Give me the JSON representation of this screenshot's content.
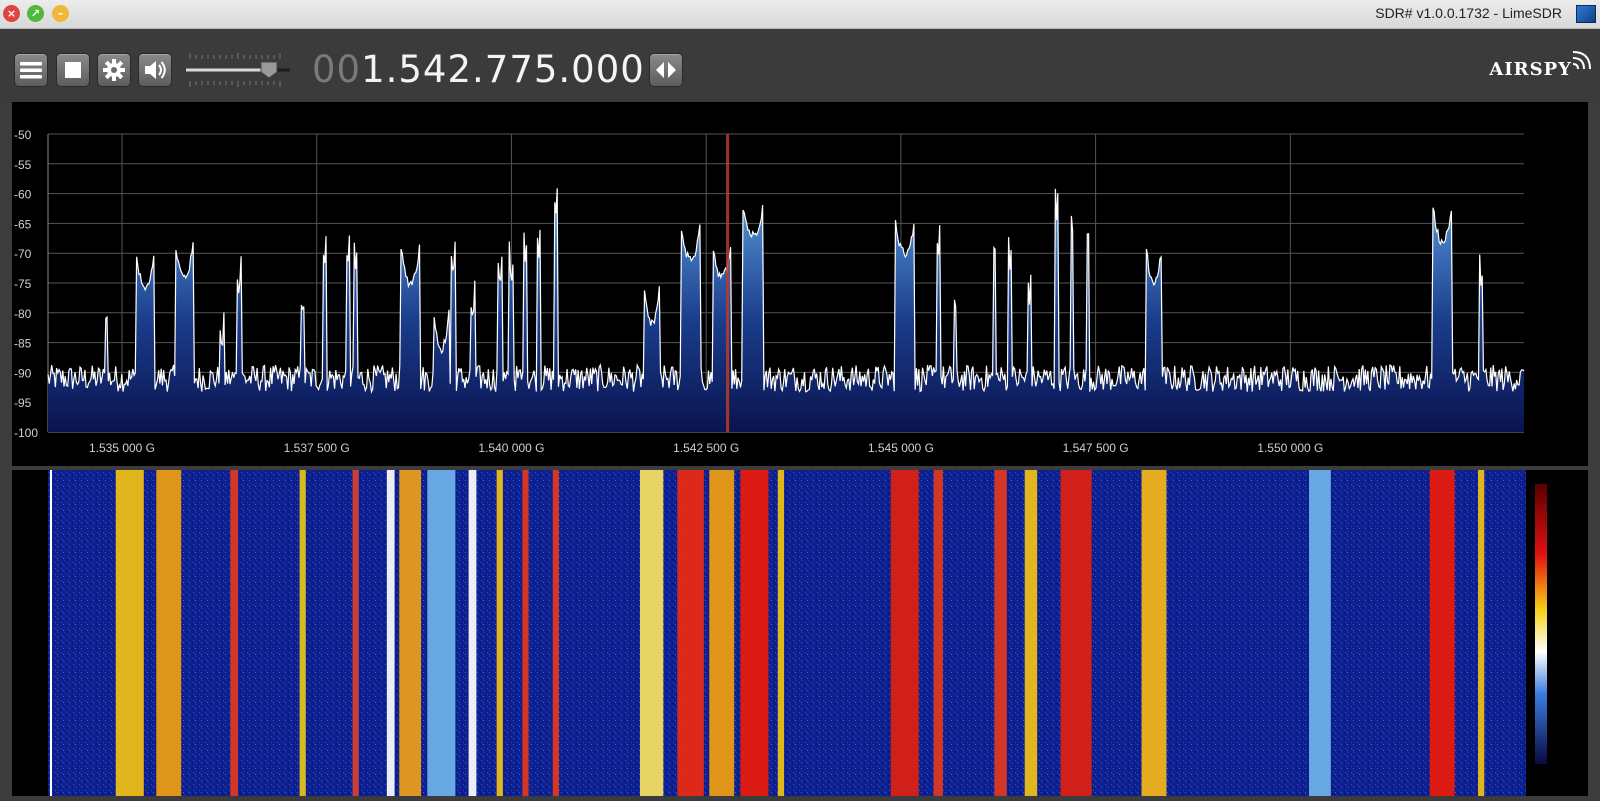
{
  "window": {
    "title": "SDR# v1.0.0.1732 - LimeSDR",
    "close_glyph": "×",
    "maximize_glyph": "↗",
    "minimize_glyph": "–"
  },
  "toolbar": {
    "menu_icon": "hamburger-menu-icon",
    "stop_icon": "stop-icon",
    "settings_icon": "gear-icon",
    "audio_icon": "speaker-icon",
    "volume_level": 0.8,
    "frequency_dim": "00",
    "frequency_main": "1.542.775.000",
    "tuning_icon": "left-right-arrows-icon",
    "logo": "AIRSPY"
  },
  "colors": {
    "background": "#3c3c3c",
    "plot_bg": "#000000",
    "trace": "#ffffff",
    "fill_top": "#4a8fd0",
    "fill_bottom": "#0a1550",
    "vfo_marker": "#c0392b",
    "waterfall_low": "#0c1f8c"
  },
  "chart_data": {
    "type": "area",
    "title": "",
    "xlabel": "",
    "ylabel": "",
    "x_unit": "GHz",
    "xlim": [
      1.53405,
      1.553
    ],
    "ylim": [
      -100,
      -50
    ],
    "y_ticks": [
      "-50",
      "-55",
      "-60",
      "-65",
      "-70",
      "-75",
      "-80",
      "-85",
      "-90",
      "-95",
      "-100"
    ],
    "x_ticks": [
      {
        "value": 1.535,
        "label": "1.535 000 G"
      },
      {
        "value": 1.5375,
        "label": "1.537 500 G"
      },
      {
        "value": 1.54,
        "label": "1.540 000 G"
      },
      {
        "value": 1.5425,
        "label": "1.542 500 G"
      },
      {
        "value": 1.545,
        "label": "1.545 000 G"
      },
      {
        "value": 1.5475,
        "label": "1.547 500 G"
      },
      {
        "value": 1.55,
        "label": "1.550 000 G"
      }
    ],
    "grid": true,
    "noise_floor_dB": -91,
    "vfo_frequency": 1.542775,
    "series": [
      {
        "values_note_free": true,
        "peaks": [
          {
            "f": 1.5348,
            "level": -82,
            "width": 2e-05
          },
          {
            "f": 1.5353,
            "level": -76,
            "width": 0.00012
          },
          {
            "f": 1.5358,
            "level": -74,
            "width": 0.00012
          },
          {
            "f": 1.53628,
            "level": -86,
            "width": 3e-05
          },
          {
            "f": 1.5365,
            "level": -76,
            "width": 3e-05
          },
          {
            "f": 1.53732,
            "level": -80,
            "width": 3e-05
          },
          {
            "f": 1.5376,
            "level": -72,
            "width": 2e-05
          },
          {
            "f": 1.5379,
            "level": -72,
            "width": 2e-05
          },
          {
            "f": 1.538,
            "level": -73,
            "width": 2e-05
          },
          {
            "f": 1.5387,
            "level": -75,
            "width": 0.00012
          },
          {
            "f": 1.5391,
            "level": -86,
            "width": 0.0001
          },
          {
            "f": 1.53925,
            "level": -73,
            "width": 3e-05
          },
          {
            "f": 1.5395,
            "level": -81,
            "width": 3e-05
          },
          {
            "f": 1.53985,
            "level": -75,
            "width": 3e-05
          },
          {
            "f": 1.54,
            "level": -74,
            "width": 3e-05
          },
          {
            "f": 1.54018,
            "level": -71,
            "width": 2e-05
          },
          {
            "f": 1.54035,
            "level": -70,
            "width": 2e-05
          },
          {
            "f": 1.54057,
            "level": -64,
            "width": 2e-05
          },
          {
            "f": 1.5418,
            "level": -82,
            "width": 0.0001
          },
          {
            "f": 1.5423,
            "level": -71,
            "width": 0.00013
          },
          {
            "f": 1.5427,
            "level": -74,
            "width": 0.00012
          },
          {
            "f": 1.5431,
            "level": -67,
            "width": 0.00014
          },
          {
            "f": 1.54505,
            "level": -70,
            "width": 0.00013
          },
          {
            "f": 1.54548,
            "level": -70,
            "width": 2e-05
          },
          {
            "f": 1.5457,
            "level": -80,
            "width": 2e-05
          },
          {
            "f": 1.5462,
            "level": -70,
            "width": 2e-05
          },
          {
            "f": 1.5464,
            "level": -72,
            "width": 2e-05
          },
          {
            "f": 1.54665,
            "level": -78,
            "width": 2e-05
          },
          {
            "f": 1.547,
            "level": -64,
            "width": 2e-05
          },
          {
            "f": 1.5472,
            "level": -66,
            "width": 2e-05
          },
          {
            "f": 1.5474,
            "level": -68,
            "width": 2e-05
          },
          {
            "f": 1.54825,
            "level": -75,
            "width": 0.0001
          },
          {
            "f": 1.55195,
            "level": -68,
            "width": 0.00012
          },
          {
            "f": 1.55245,
            "level": -76,
            "width": 2e-05
          }
        ]
      }
    ]
  },
  "waterfall_bands": [
    {
      "f": 1.5351,
      "w": 0.00018,
      "color": "#f3c212"
    },
    {
      "f": 1.5356,
      "w": 0.00016,
      "color": "#f0a010"
    },
    {
      "f": 1.53644,
      "w": 5e-05,
      "color": "#e23a1b"
    },
    {
      "f": 1.53732,
      "w": 4e-05,
      "color": "#e8c817"
    },
    {
      "f": 1.538,
      "w": 4e-05,
      "color": "#d94030"
    },
    {
      "f": 1.53845,
      "w": 5e-05,
      "color": "#ffffff"
    },
    {
      "f": 1.5387,
      "w": 0.00014,
      "color": "#f0a018"
    },
    {
      "f": 1.5391,
      "w": 0.00018,
      "color": "#6fb4ea"
    },
    {
      "f": 1.5395,
      "w": 5e-05,
      "color": "#ffffff"
    },
    {
      "f": 1.53985,
      "w": 4e-05,
      "color": "#f3c212"
    },
    {
      "f": 1.54018,
      "w": 4e-05,
      "color": "#e23a1b"
    },
    {
      "f": 1.54057,
      "w": 4e-05,
      "color": "#e23a1b"
    },
    {
      "f": 1.5418,
      "w": 0.00015,
      "color": "#f7e460"
    },
    {
      "f": 1.5423,
      "w": 0.00017,
      "color": "#ef2a10"
    },
    {
      "f": 1.5427,
      "w": 0.00016,
      "color": "#f0a010"
    },
    {
      "f": 1.54312,
      "w": 0.00018,
      "color": "#ee1a0a"
    },
    {
      "f": 1.54346,
      "w": 4e-05,
      "color": "#f3c212"
    },
    {
      "f": 1.54505,
      "w": 0.00018,
      "color": "#e22010"
    },
    {
      "f": 1.54548,
      "w": 6e-05,
      "color": "#e23a1b"
    },
    {
      "f": 1.54628,
      "w": 8e-05,
      "color": "#e23a1b"
    },
    {
      "f": 1.54667,
      "w": 8e-05,
      "color": "#f3c212"
    },
    {
      "f": 1.54725,
      "w": 0.0002,
      "color": "#e22010"
    },
    {
      "f": 1.54825,
      "w": 0.00016,
      "color": "#f7b818"
    },
    {
      "f": 1.55038,
      "w": 0.00014,
      "color": "#6fb4ea"
    },
    {
      "f": 1.55195,
      "w": 0.00016,
      "color": "#ee1a0a"
    },
    {
      "f": 1.55245,
      "w": 4e-05,
      "color": "#f3c212"
    }
  ]
}
